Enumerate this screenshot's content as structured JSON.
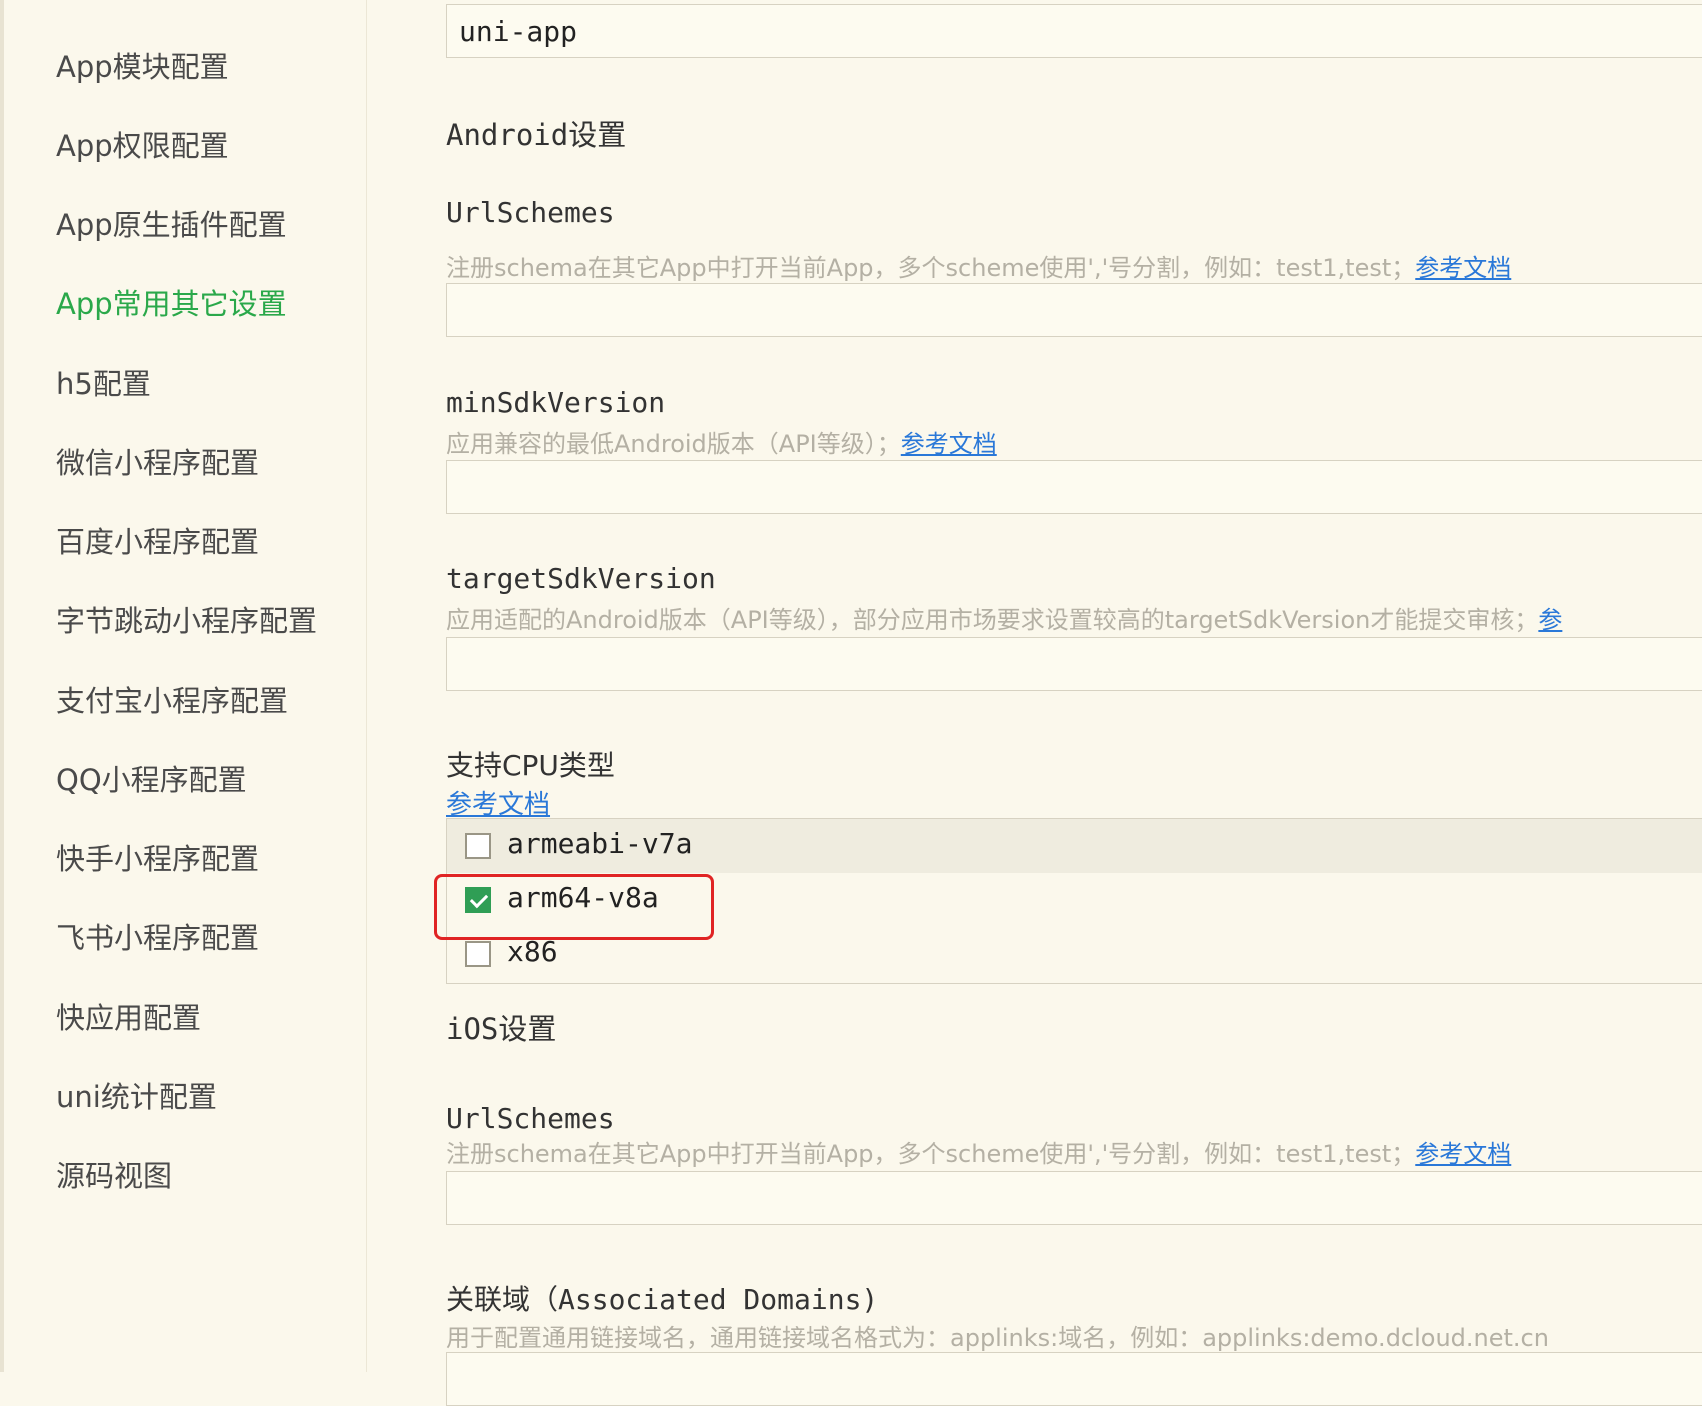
{
  "sidebar": {
    "items": [
      {
        "label": "App模块配置",
        "active": false
      },
      {
        "label": "App权限配置",
        "active": false
      },
      {
        "label": "App原生插件配置",
        "active": false
      },
      {
        "label": "App常用其它设置",
        "active": true
      },
      {
        "label": "h5配置",
        "active": false
      },
      {
        "label": "微信小程序配置",
        "active": false
      },
      {
        "label": "百度小程序配置",
        "active": false
      },
      {
        "label": "字节跳动小程序配置",
        "active": false
      },
      {
        "label": "支付宝小程序配置",
        "active": false
      },
      {
        "label": "QQ小程序配置",
        "active": false
      },
      {
        "label": "快手小程序配置",
        "active": false
      },
      {
        "label": "飞书小程序配置",
        "active": false
      },
      {
        "label": "快应用配置",
        "active": false
      },
      {
        "label": "uni统计配置",
        "active": false
      },
      {
        "label": "源码视图",
        "active": false
      }
    ]
  },
  "main": {
    "top_input_value": "uni-app",
    "android": {
      "title": "Android设置",
      "urlschemes": {
        "label": "UrlSchemes",
        "hint": "注册schema在其它App中打开当前App，多个scheme使用','号分割，例如：test1,test；",
        "link": "参考文档",
        "value": ""
      },
      "min_sdk": {
        "label": "minSdkVersion",
        "hint": "应用兼容的最低Android版本（API等级）；",
        "link": "参考文档",
        "value": ""
      },
      "target_sdk": {
        "label": "targetSdkVersion",
        "hint": "应用适配的Android版本（API等级），部分应用市场要求设置较高的targetSdkVersion才能提交审核；",
        "link": "参",
        "value": ""
      },
      "cpu": {
        "label": "支持CPU类型",
        "link": "参考文档",
        "options": [
          {
            "label": "armeabi-v7a",
            "checked": false
          },
          {
            "label": "arm64-v8a",
            "checked": true
          },
          {
            "label": "x86",
            "checked": false
          }
        ]
      }
    },
    "ios": {
      "title": "iOS设置",
      "urlschemes": {
        "label": "UrlSchemes",
        "hint": "注册schema在其它App中打开当前App，多个scheme使用','号分割，例如：test1,test；",
        "link": "参考文档",
        "value": ""
      },
      "associated_domains": {
        "label": "关联域（Associated Domains)",
        "hint": "用于配置通用链接域名，通用链接域名格式为：applinks:域名，例如：applinks:demo.dcloud.net.cn",
        "value": ""
      }
    }
  },
  "colors": {
    "background": "#fbf8ec",
    "accent_green": "#2aa84a",
    "link_blue": "#2a78d8",
    "highlight_red": "#e02424"
  }
}
